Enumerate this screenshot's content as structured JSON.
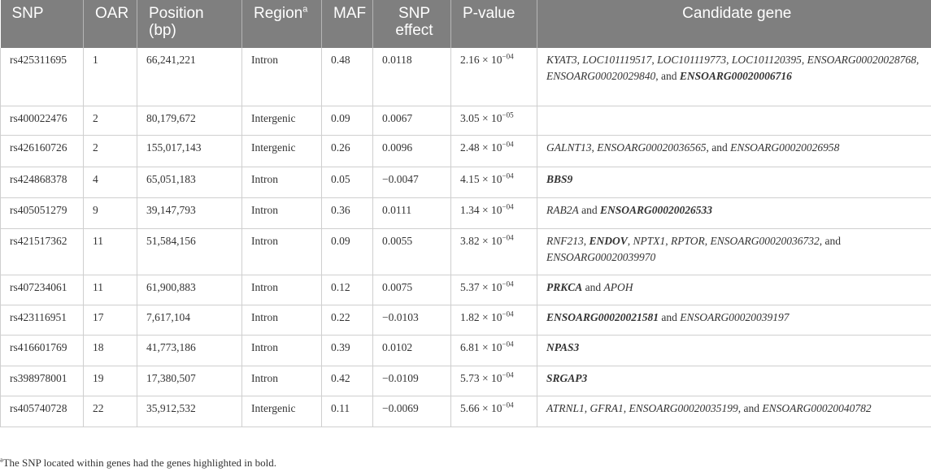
{
  "headers": {
    "snp": "SNP",
    "oar": "OAR",
    "position_1": "Position",
    "position_2": "(bp)",
    "region": "Region",
    "region_sup": "a",
    "maf": "MAF",
    "effect_1": "SNP",
    "effect_2": "effect",
    "pvalue": "P-value",
    "gene": "Candidate gene"
  },
  "rows": [
    {
      "snp": "rs425311695",
      "oar": "1",
      "position": "66,241,221",
      "region": "Intron",
      "maf": "0.48",
      "effect": "0.0118",
      "p_base": "2.16 × 10",
      "p_exp": "−04",
      "genes": [
        {
          "t": "KYAT3",
          "b": false
        },
        {
          "t": ", ",
          "s": true
        },
        {
          "t": "LOC101119517",
          "b": false
        },
        {
          "t": ", ",
          "s": true
        },
        {
          "t": "LOC101119773",
          "b": false
        },
        {
          "t": ", ",
          "s": true
        },
        {
          "t": "LOC101120395",
          "b": false
        },
        {
          "t": ", ",
          "s": true
        },
        {
          "t": "ENSOARG00020028768",
          "b": false
        },
        {
          "t": ", ",
          "s": true
        },
        {
          "t": "ENSOARG00020029840",
          "b": false
        },
        {
          "t": ", and ",
          "s": true
        },
        {
          "t": "ENSOARG00020006716",
          "b": true
        }
      ]
    },
    {
      "snp": "rs400022476",
      "oar": "2",
      "position": "80,179,672",
      "region": "Intergenic",
      "maf": "0.09",
      "effect": "0.0067",
      "p_base": "3.05 × 10",
      "p_exp": "−05",
      "genes": []
    },
    {
      "snp": "rs426160726",
      "oar": "2",
      "position": "155,017,143",
      "region": "Intergenic",
      "maf": "0.26",
      "effect": "0.0096",
      "p_base": "2.48 × 10",
      "p_exp": "−04",
      "genes": [
        {
          "t": "GALNT13",
          "b": false
        },
        {
          "t": ", ",
          "s": true
        },
        {
          "t": "ENSOARG00020036565",
          "b": false
        },
        {
          "t": ", and ",
          "s": true
        },
        {
          "t": "ENSOARG00020026958",
          "b": false
        }
      ]
    },
    {
      "snp": "rs424868378",
      "oar": "4",
      "position": "65,051,183",
      "region": "Intron",
      "maf": "0.05",
      "effect": "−0.0047",
      "p_base": "4.15 × 10",
      "p_exp": "−04",
      "genes": [
        {
          "t": "BBS9",
          "b": true
        }
      ]
    },
    {
      "snp": "rs405051279",
      "oar": "9",
      "position": "39,147,793",
      "region": "Intron",
      "maf": "0.36",
      "effect": "0.0111",
      "p_base": "1.34 × 10",
      "p_exp": "−04",
      "genes": [
        {
          "t": "RAB2A",
          "b": false
        },
        {
          "t": " and ",
          "s": true
        },
        {
          "t": "ENSOARG00020026533",
          "b": true
        }
      ]
    },
    {
      "snp": "rs421517362",
      "oar": "11",
      "position": "51,584,156",
      "region": "Intron",
      "maf": "0.09",
      "effect": "0.0055",
      "p_base": "3.82 × 10",
      "p_exp": "−04",
      "genes": [
        {
          "t": "RNF213",
          "b": false
        },
        {
          "t": ", ",
          "s": true
        },
        {
          "t": "ENDOV",
          "b": true
        },
        {
          "t": ", ",
          "s": true
        },
        {
          "t": "NPTX1",
          "b": false
        },
        {
          "t": ", ",
          "s": true
        },
        {
          "t": "RPTOR",
          "b": false
        },
        {
          "t": ", ",
          "s": true
        },
        {
          "t": "ENSOARG00020036732",
          "b": false
        },
        {
          "t": ", and ",
          "s": true
        },
        {
          "t": "ENSOARG00020039970",
          "b": false
        }
      ]
    },
    {
      "snp": "rs407234061",
      "oar": "11",
      "position": "61,900,883",
      "region": "Intron",
      "maf": "0.12",
      "effect": "0.0075",
      "p_base": "5.37 × 10",
      "p_exp": "−04",
      "genes": [
        {
          "t": "PRKCA",
          "b": true
        },
        {
          "t": " and ",
          "s": true
        },
        {
          "t": "APOH",
          "b": false
        }
      ]
    },
    {
      "snp": "rs423116951",
      "oar": "17",
      "position": "7,617,104",
      "region": "Intron",
      "maf": "0.22",
      "effect": "−0.0103",
      "p_base": "1.82 × 10",
      "p_exp": "−04",
      "genes": [
        {
          "t": "ENSOARG00020021581",
          "b": true
        },
        {
          "t": " and ",
          "s": true
        },
        {
          "t": "ENSOARG00020039197",
          "b": false
        }
      ]
    },
    {
      "snp": "rs416601769",
      "oar": "18",
      "position": "41,773,186",
      "region": "Intron",
      "maf": "0.39",
      "effect": "0.0102",
      "p_base": "6.81 × 10",
      "p_exp": "−04",
      "genes": [
        {
          "t": "NPAS3",
          "b": true
        }
      ]
    },
    {
      "snp": "rs398978001",
      "oar": "19",
      "position": "17,380,507",
      "region": "Intron",
      "maf": "0.42",
      "effect": "−0.0109",
      "p_base": "5.73 × 10",
      "p_exp": "−04",
      "genes": [
        {
          "t": "SRGAP3",
          "b": true
        }
      ]
    },
    {
      "snp": "rs405740728",
      "oar": "22",
      "position": "35,912,532",
      "region": "Intergenic",
      "maf": "0.11",
      "effect": "−0.0069",
      "p_base": "5.66 × 10",
      "p_exp": "−04",
      "genes": [
        {
          "t": "ATRNL1",
          "b": false
        },
        {
          "t": ", ",
          "s": true
        },
        {
          "t": "GFRA1",
          "b": false
        },
        {
          "t": ", ",
          "s": true
        },
        {
          "t": "ENSOARG00020035199",
          "b": false
        },
        {
          "t": ", and ",
          "s": true
        },
        {
          "t": "ENSOARG00020040782",
          "b": false
        }
      ]
    }
  ],
  "footnote": {
    "marker": "a",
    "text": "The SNP located within genes had the genes highlighted in bold."
  }
}
